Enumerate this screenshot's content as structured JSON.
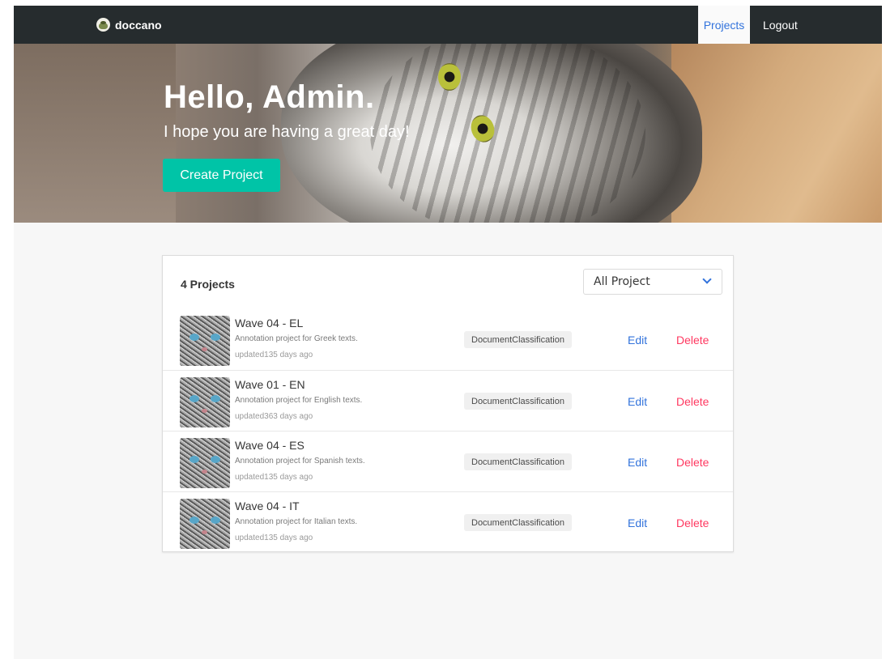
{
  "navbar": {
    "brand": "doccano",
    "brand_icon": "doccano-logo-icon",
    "projects_label": "Projects",
    "logout_label": "Logout"
  },
  "hero": {
    "title": "Hello, Admin.",
    "subtitle": "I hope you are having a great day!",
    "create_button": "Create Project"
  },
  "projects_panel": {
    "count_label": "4 Projects",
    "filter": {
      "selected": "All Project",
      "icon": "chevron-down-icon"
    },
    "rows": [
      {
        "title": "Wave 04 - EL",
        "description": "Annotation project for Greek texts.",
        "updated": "updated135 days ago",
        "type": "DocumentClassification",
        "edit": "Edit",
        "delete": "Delete"
      },
      {
        "title": "Wave 01 - EN",
        "description": "Annotation project for English texts.",
        "updated": "updated363 days ago",
        "type": "DocumentClassification",
        "edit": "Edit",
        "delete": "Delete"
      },
      {
        "title": "Wave 04 - ES",
        "description": "Annotation project for Spanish texts.",
        "updated": "updated135 days ago",
        "type": "DocumentClassification",
        "edit": "Edit",
        "delete": "Delete"
      },
      {
        "title": "Wave 04 - IT",
        "description": "Annotation project for Italian texts.",
        "updated": "updated135 days ago",
        "type": "DocumentClassification",
        "edit": "Edit",
        "delete": "Delete"
      }
    ]
  },
  "colors": {
    "navbar": "#262c2e",
    "accent_link": "#3273dc",
    "primary_button": "#00c4a7",
    "danger": "#ff3860",
    "page_background": "#f7f7f7"
  }
}
